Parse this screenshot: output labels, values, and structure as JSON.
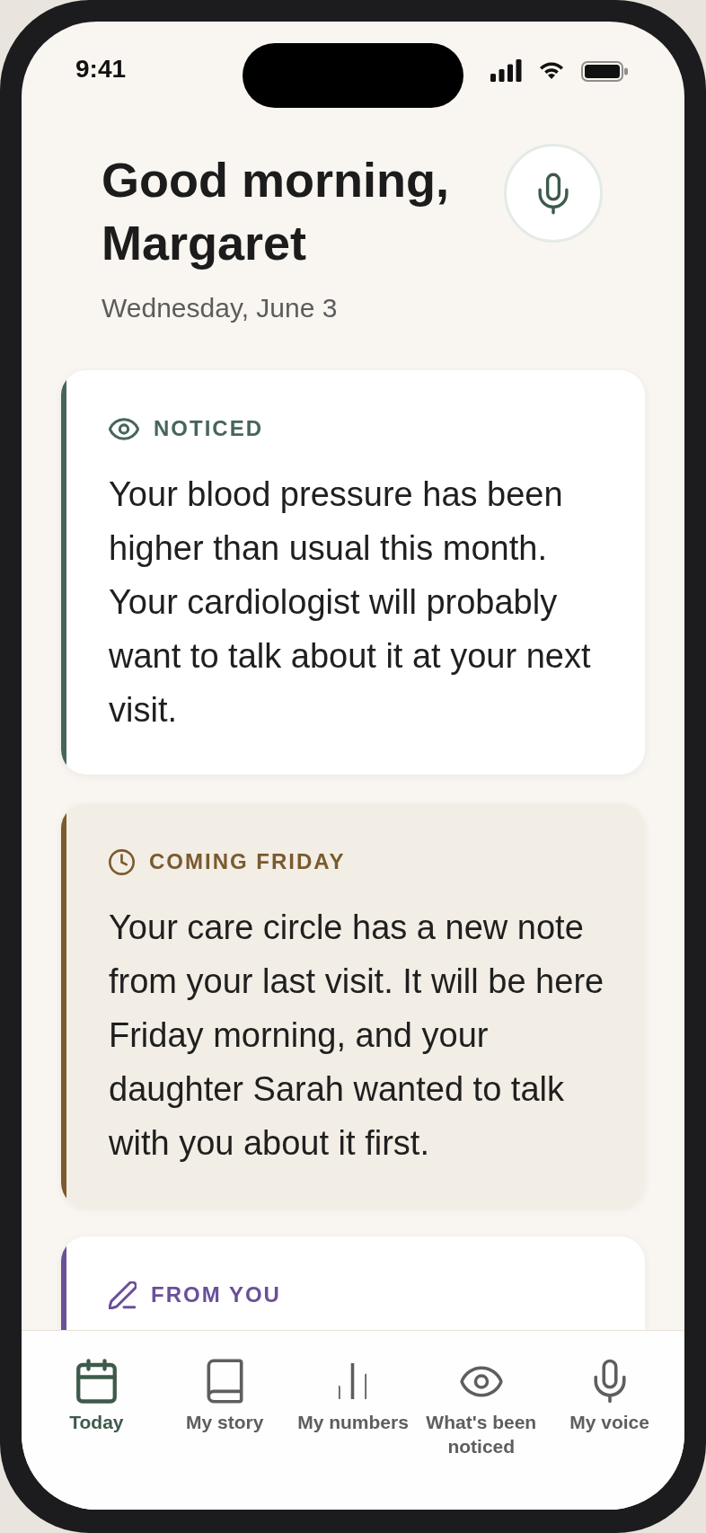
{
  "status_bar": {
    "time": "9:41"
  },
  "header": {
    "greeting": "Good morning, Margaret",
    "date": "Wednesday, June 3"
  },
  "cards": [
    {
      "kind": "noticed",
      "label": "NOTICED",
      "body": "Your blood pressure has been higher than usual this month. Your cardiologist will probably want to talk about it at your next visit.",
      "color": "#46665a"
    },
    {
      "kind": "upcoming",
      "label": "COMING FRIDAY",
      "body": "Your care circle has a new note from your last visit. It will be here Friday morning, and your daughter Sarah wanted to talk with you about it first.",
      "color": "#7a5a2e"
    },
    {
      "kind": "note",
      "label": "FROM YOU",
      "color": "#6a4f9a"
    }
  ],
  "tabs": [
    {
      "label": "Today",
      "selected": true
    },
    {
      "label": "My story",
      "selected": false
    },
    {
      "label": "My numbers",
      "selected": false
    },
    {
      "label": "What's been noticed",
      "selected": false
    },
    {
      "label": "My voice",
      "selected": false
    }
  ]
}
